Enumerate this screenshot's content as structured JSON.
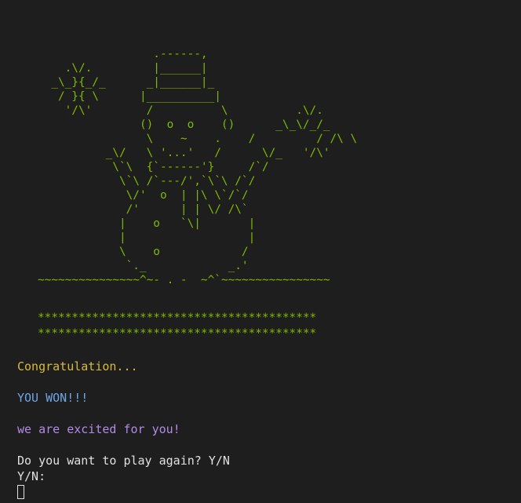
{
  "colors": {
    "background": "#1e1e1e",
    "art": "#7fb800",
    "congrats": "#d7ba3d",
    "won": "#6fa6e6",
    "excited": "#b48ae8",
    "prompt": "#e0e0e0"
  },
  "art": {
    "snowman": "                    .------,\n       .\\/.         |______|\n     _\\_}{_/_      _|______|_\n      / }{ \\      |__________|\n       '/\\'        /          \\          .\\/.\n                  ()  o  o    ()      _\\_\\/_/_\n                   \\    ~    .    /         / /\\ \\\n             _\\/   \\ '...'   /      \\/_   '/\\'\n              \\`\\  {`------'}     /`/\n               \\`\\ /`---/',`\\`\\ /`/\n                \\/'  o  | |\\ \\`/`/\n                /'      | | \\/ /\\`\n               |    o   `\\|       |\n               |                  |\n               \\    o            /\n                `._            _.'\n   ~~~~~~~~~~~~~~~^~- . -  ~^`~~~~~~~~~~~~~~~~"
  },
  "grass": {
    "row1": "   *****************************************",
    "row2": "   *****************************************"
  },
  "messages": {
    "congrats": "Congratulation...",
    "won": "YOU WON!!!",
    "excited": "we are excited for you!",
    "prompt": "Do you want to play again? Y/N",
    "input_label": "Y/N:"
  }
}
